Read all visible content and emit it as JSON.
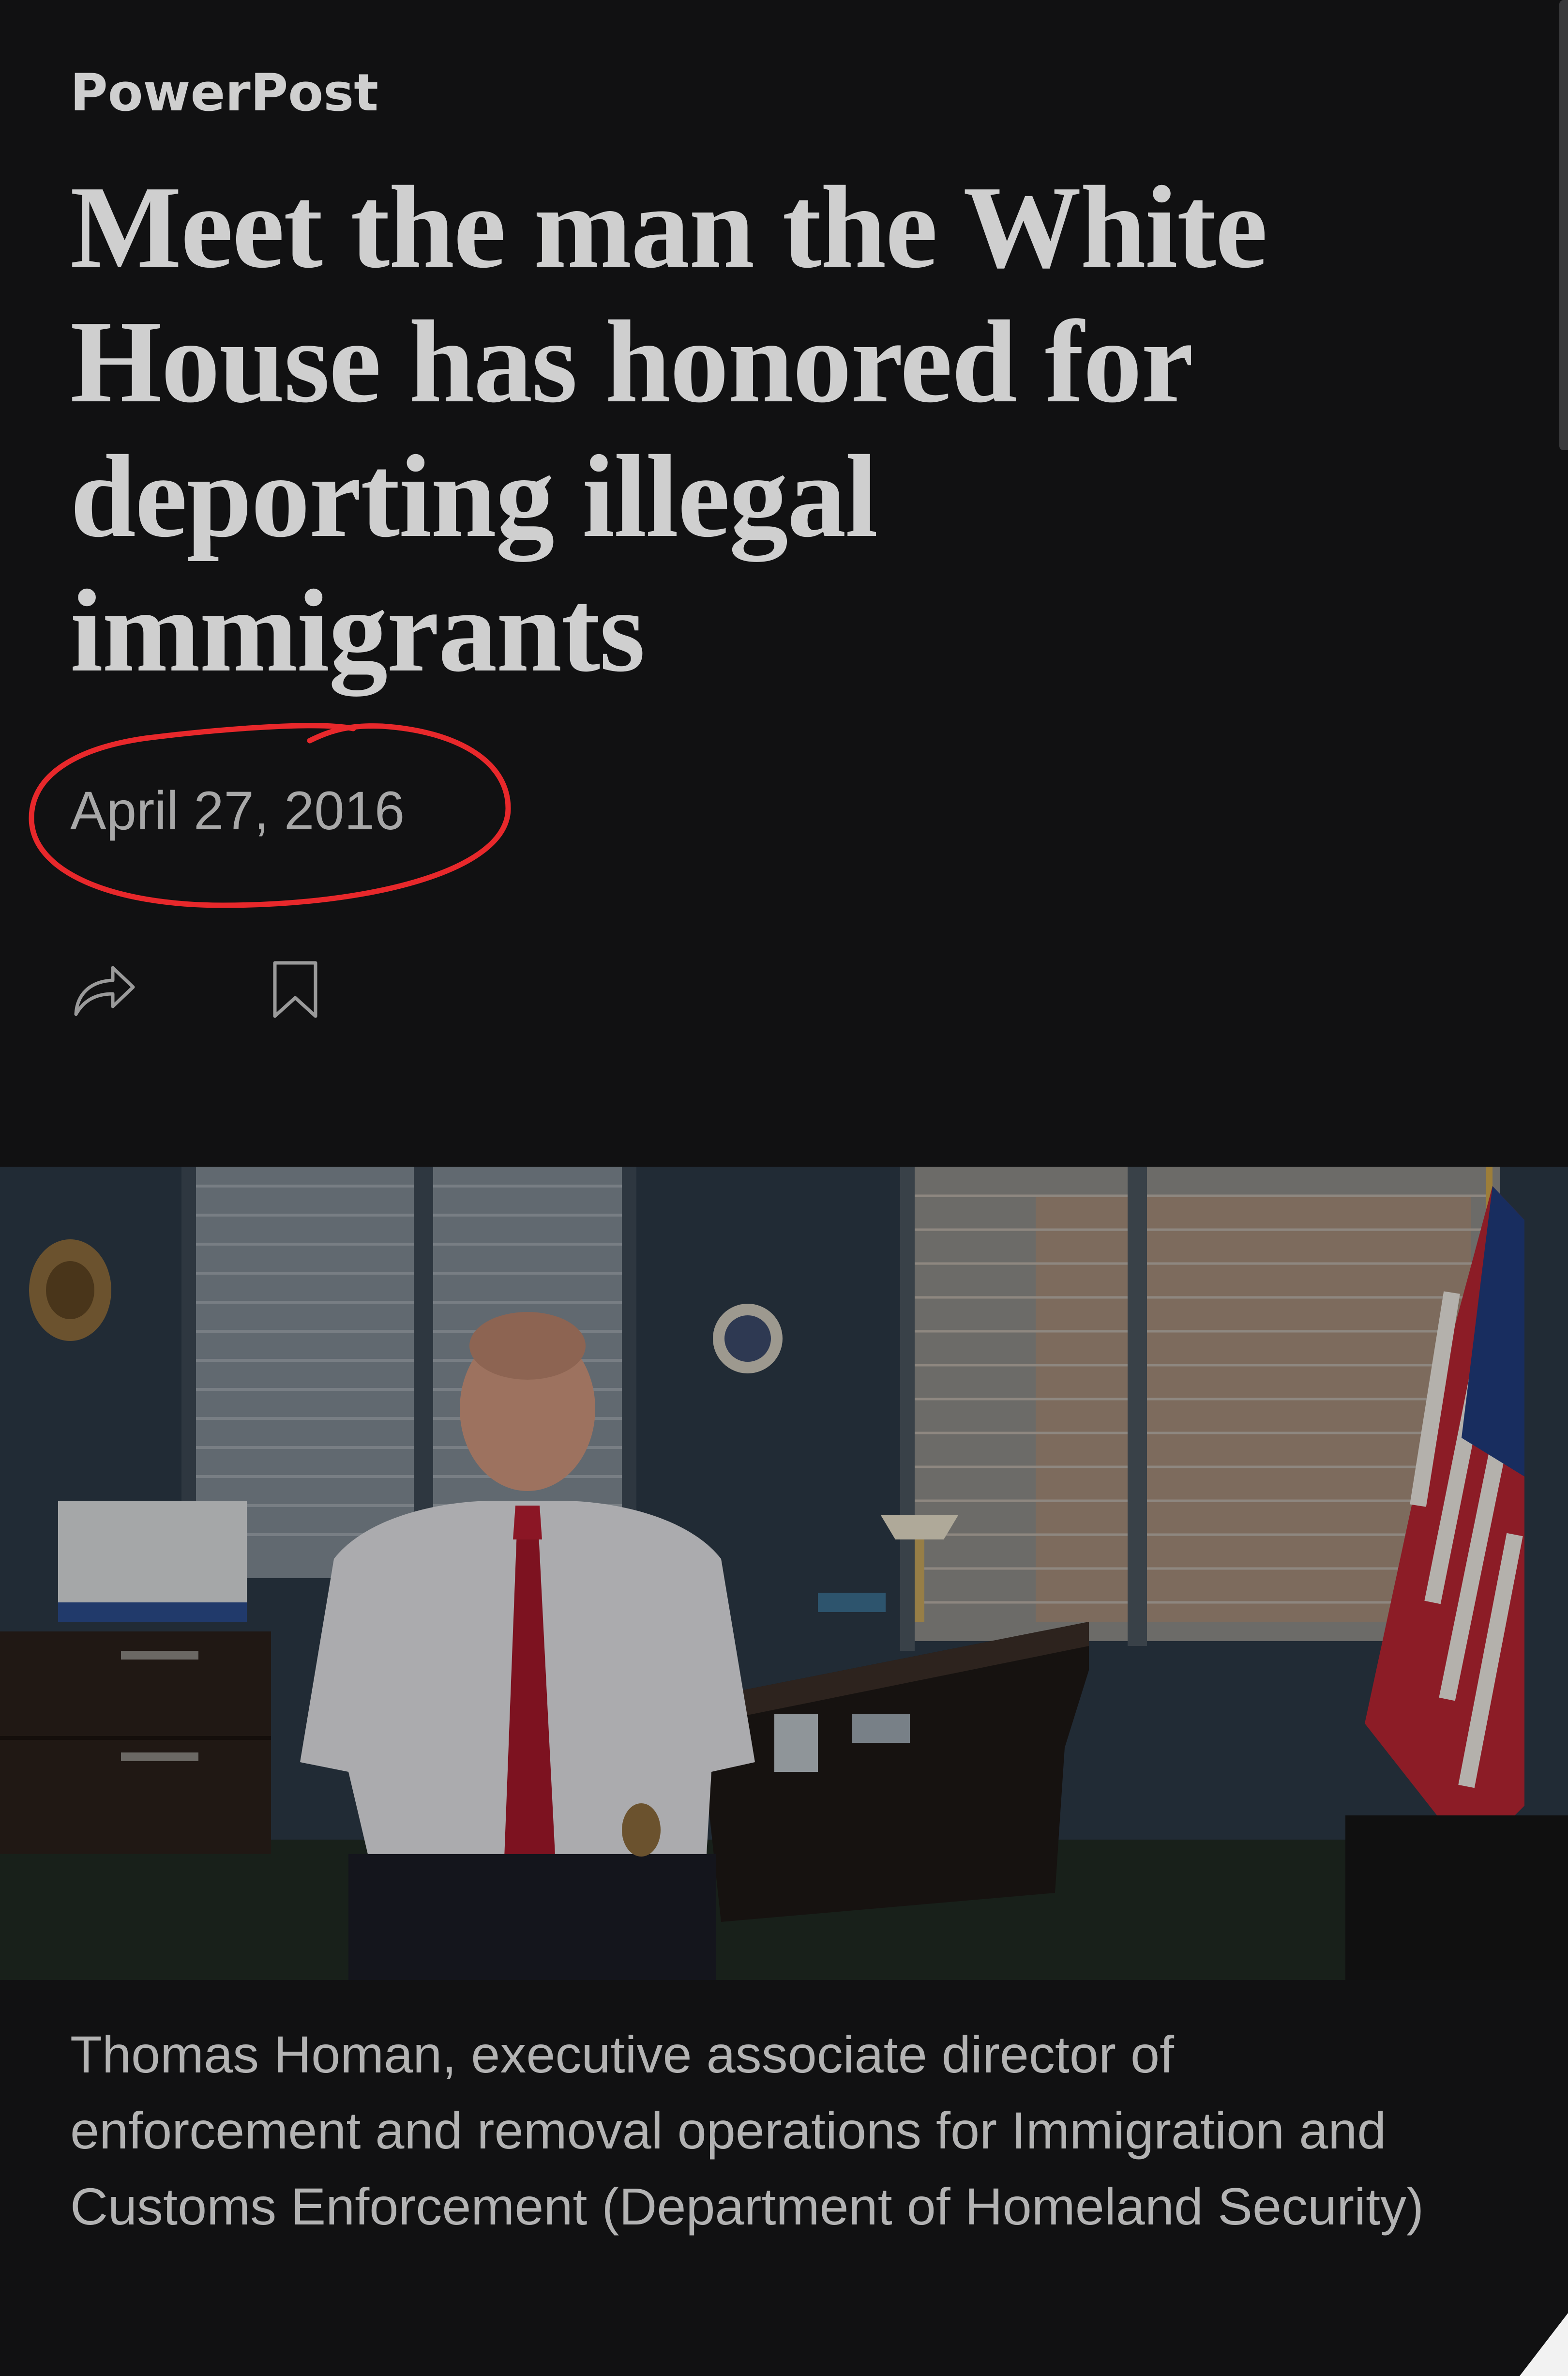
{
  "article": {
    "section": "PowerPost",
    "headline": "Meet the man the White House has honored for deporting illegal immigrants",
    "date": "April 27, 2016",
    "caption": "Thomas Homan, executive associate director of enforcement and removal operations for Immigration and Customs Enforcement (Department of Homeland Security)"
  },
  "actions": {
    "share_icon": "share-arrow-icon",
    "bookmark_icon": "bookmark-icon"
  },
  "annotation": {
    "circle_color": "#e8282b"
  },
  "colors": {
    "background": "#111112",
    "text": "#cfcfcf",
    "muted_text": "#a8a8a8"
  }
}
